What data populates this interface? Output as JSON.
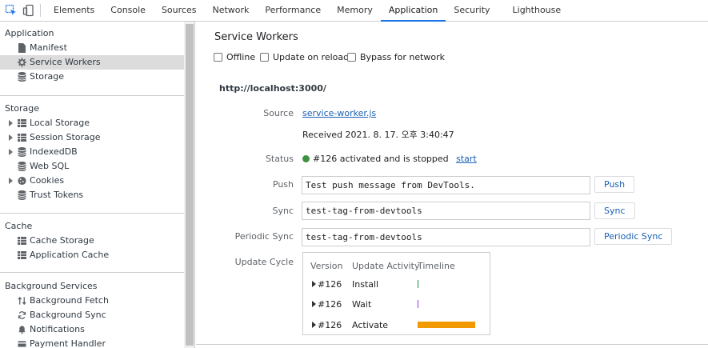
{
  "toolbar": {
    "tabs": [
      "Elements",
      "Console",
      "Sources",
      "Network",
      "Performance",
      "Memory",
      "Application",
      "Security",
      "Lighthouse"
    ],
    "active_tab": "Application"
  },
  "sidebar": {
    "application": {
      "header": "Application",
      "items": [
        {
          "label": "Manifest",
          "icon": "file-icon"
        },
        {
          "label": "Service Workers",
          "icon": "gear-icon",
          "selected": true
        },
        {
          "label": "Storage",
          "icon": "database-icon"
        }
      ]
    },
    "storage": {
      "header": "Storage",
      "items": [
        {
          "label": "Local Storage",
          "icon": "grid-icon",
          "expandable": true
        },
        {
          "label": "Session Storage",
          "icon": "grid-icon",
          "expandable": true
        },
        {
          "label": "IndexedDB",
          "icon": "database-icon",
          "expandable": true
        },
        {
          "label": "Web SQL",
          "icon": "database-icon"
        },
        {
          "label": "Cookies",
          "icon": "cookie-icon",
          "expandable": true
        },
        {
          "label": "Trust Tokens",
          "icon": "database-icon"
        }
      ]
    },
    "cache": {
      "header": "Cache",
      "items": [
        {
          "label": "Cache Storage",
          "icon": "grid-icon"
        },
        {
          "label": "Application Cache",
          "icon": "grid-icon"
        }
      ]
    },
    "background_services": {
      "header": "Background Services",
      "items": [
        {
          "label": "Background Fetch",
          "icon": "arrows-icon"
        },
        {
          "label": "Background Sync",
          "icon": "sync-icon"
        },
        {
          "label": "Notifications",
          "icon": "bell-icon"
        },
        {
          "label": "Payment Handler",
          "icon": "card-icon"
        }
      ]
    }
  },
  "main": {
    "title": "Service Workers",
    "options": {
      "offline": "Offline",
      "update_on_reload": "Update on reload",
      "bypass": "Bypass for network"
    },
    "origin": "http://localhost:3000/",
    "source_label": "Source",
    "source_link": "service-worker.js",
    "received": "Received 2021. 8. 17. 오후 3:40:47",
    "status_label": "Status",
    "status_text": "#126 activated and is stopped",
    "status_link": "start",
    "status_color": "#3f9142",
    "push_label": "Push",
    "push_value": "Test push message from DevTools.",
    "push_button": "Push",
    "sync_label": "Sync",
    "sync_value": "test-tag-from-devtools",
    "sync_button": "Sync",
    "periodic_label": "Periodic Sync",
    "periodic_value": "test-tag-from-devtools",
    "periodic_button": "Periodic Sync",
    "update_cycle_label": "Update Cycle",
    "update_cycle": {
      "headers": {
        "version": "Version",
        "activity": "Update Activity",
        "timeline": "Timeline"
      },
      "rows": [
        {
          "version": "#126",
          "activity": "Install",
          "timeline_color": "#1e8e3e"
        },
        {
          "version": "#126",
          "activity": "Wait",
          "timeline_color": "#9334e6"
        },
        {
          "version": "#126",
          "activity": "Activate",
          "timeline_color": "#f29900"
        }
      ]
    }
  }
}
